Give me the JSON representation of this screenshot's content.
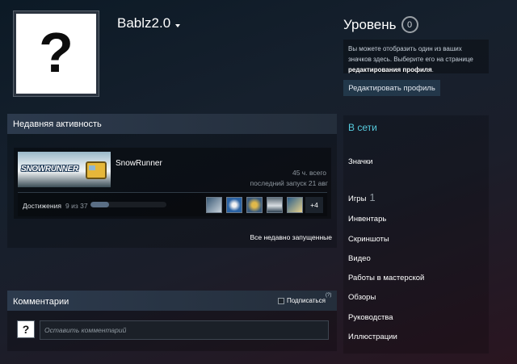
{
  "profile": {
    "username": "Bablz2.0",
    "avatar_glyph": "?"
  },
  "level": {
    "title": "Уровень",
    "value": "0",
    "info_text": "Вы можете отобразить один из ваших значков здесь. Выберите его на странице ",
    "info_link": "редактирования профиля",
    "info_end": ".",
    "edit_button": "Редактировать профиль"
  },
  "recent": {
    "header": "Недавняя активность",
    "game": {
      "name": "SnowRunner",
      "capsule_logo": "SNOWRUNNER",
      "hours": "45 ч. всего",
      "last_played": "последний запуск 21 авг"
    },
    "achievements": {
      "label": "Достижения",
      "count": "9 из 37",
      "progress": 0.243,
      "icons": [
        "achievement-icon-1",
        "achievement-icon-2",
        "achievement-icon-3",
        "achievement-icon-4",
        "achievement-icon-5"
      ],
      "more": "+4"
    },
    "all_recent_link": "Все недавно запущенные"
  },
  "comments": {
    "header": "Комментарии",
    "subscribe_label": "Подписаться",
    "help_mark": "(?)",
    "avatar_glyph": "?",
    "placeholder": "Оставить комментарий"
  },
  "sidebar": {
    "status": "В сети",
    "badges": "Значки",
    "games": "Игры",
    "games_count": "1",
    "inventory": "Инвентарь",
    "screenshots": "Скриншоты",
    "videos": "Видео",
    "workshop": "Работы в мастерской",
    "reviews": "Обзоры",
    "guides": "Руководства",
    "artwork": "Иллюстрации"
  },
  "colors": {
    "status_online": "#57cbde",
    "accent_button": "#2a3f55"
  }
}
